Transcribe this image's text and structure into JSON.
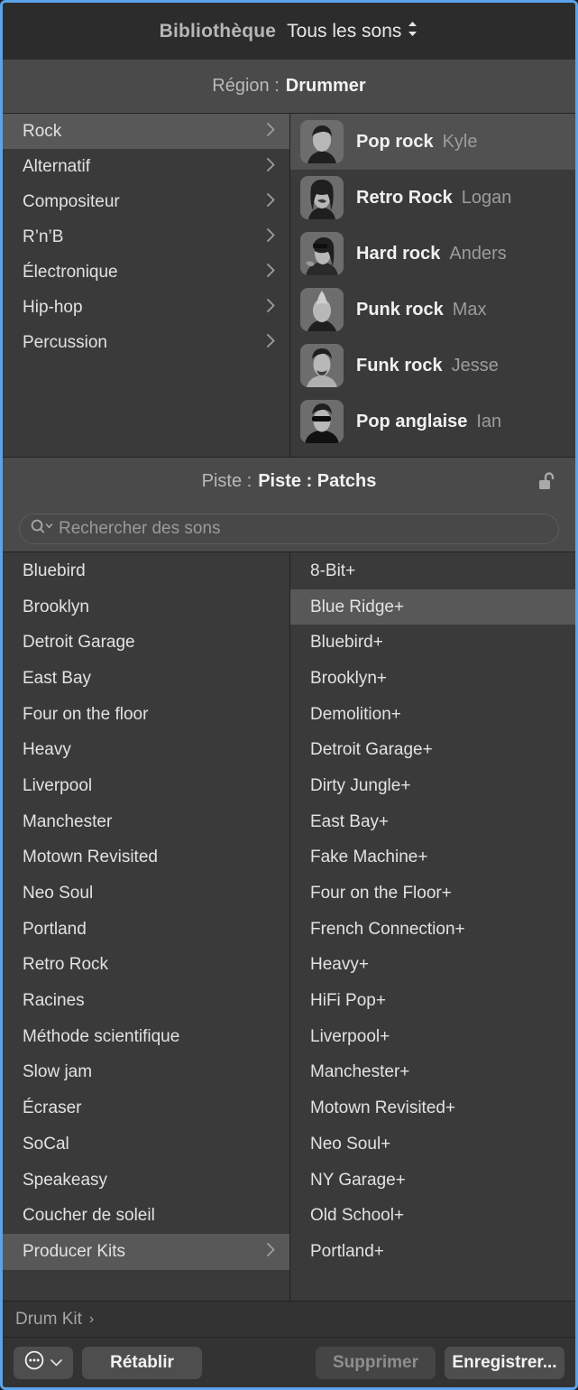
{
  "library": {
    "title": "Bibliothèque",
    "filter_label": "Tous les sons",
    "filter_icon": "chevron-up-down-icon"
  },
  "region": {
    "label": "Région :",
    "value": "Drummer"
  },
  "genres": [
    {
      "label": "Rock",
      "selected": true
    },
    {
      "label": "Alternatif",
      "selected": false
    },
    {
      "label": "Compositeur",
      "selected": false
    },
    {
      "label": "R’n’B",
      "selected": false
    },
    {
      "label": "Électronique",
      "selected": false
    },
    {
      "label": "Hip-hop",
      "selected": false
    },
    {
      "label": "Percussion",
      "selected": false
    }
  ],
  "drummers": [
    {
      "style": "Pop rock",
      "name": "Kyle",
      "selected": true,
      "avatar": "avatar-kyle"
    },
    {
      "style": "Retro Rock",
      "name": "Logan",
      "selected": false,
      "avatar": "avatar-logan"
    },
    {
      "style": "Hard rock",
      "name": "Anders",
      "selected": false,
      "avatar": "avatar-anders"
    },
    {
      "style": "Punk rock",
      "name": "Max",
      "selected": false,
      "avatar": "avatar-max"
    },
    {
      "style": "Funk rock",
      "name": "Jesse",
      "selected": false,
      "avatar": "avatar-jesse"
    },
    {
      "style": "Pop anglaise",
      "name": "Ian",
      "selected": false,
      "avatar": "avatar-ian"
    }
  ],
  "track": {
    "label": "Piste :",
    "value": "Piste : Patchs",
    "lock_icon": "unlocked-padlock-icon"
  },
  "search": {
    "placeholder": "Rechercher des sons",
    "value": "",
    "icon": "search-icon"
  },
  "patches_left": [
    {
      "label": "Bluebird",
      "selected": false,
      "chevron": false
    },
    {
      "label": "Brooklyn",
      "selected": false,
      "chevron": false
    },
    {
      "label": "Detroit Garage",
      "selected": false,
      "chevron": false
    },
    {
      "label": "East Bay",
      "selected": false,
      "chevron": false
    },
    {
      "label": "Four on the floor",
      "selected": false,
      "chevron": false
    },
    {
      "label": "Heavy",
      "selected": false,
      "chevron": false
    },
    {
      "label": "Liverpool",
      "selected": false,
      "chevron": false
    },
    {
      "label": "Manchester",
      "selected": false,
      "chevron": false
    },
    {
      "label": "Motown Revisited",
      "selected": false,
      "chevron": false
    },
    {
      "label": "Neo Soul",
      "selected": false,
      "chevron": false
    },
    {
      "label": "Portland",
      "selected": false,
      "chevron": false
    },
    {
      "label": "Retro Rock",
      "selected": false,
      "chevron": false
    },
    {
      "label": "Racines",
      "selected": false,
      "chevron": false
    },
    {
      "label": "Méthode scientifique",
      "selected": false,
      "chevron": false
    },
    {
      "label": "Slow jam",
      "selected": false,
      "chevron": false
    },
    {
      "label": "Écraser",
      "selected": false,
      "chevron": false
    },
    {
      "label": "SoCal",
      "selected": false,
      "chevron": false
    },
    {
      "label": "Speakeasy",
      "selected": false,
      "chevron": false
    },
    {
      "label": "Coucher de soleil",
      "selected": false,
      "chevron": false
    },
    {
      "label": "Producer Kits",
      "selected": true,
      "chevron": true
    }
  ],
  "patches_right": [
    {
      "label": "8-Bit+",
      "selected": false
    },
    {
      "label": "Blue Ridge+",
      "selected": true
    },
    {
      "label": "Bluebird+",
      "selected": false
    },
    {
      "label": "Brooklyn+",
      "selected": false
    },
    {
      "label": "Demolition+",
      "selected": false
    },
    {
      "label": "Detroit Garage+",
      "selected": false
    },
    {
      "label": "Dirty Jungle+",
      "selected": false
    },
    {
      "label": "East Bay+",
      "selected": false
    },
    {
      "label": "Fake Machine+",
      "selected": false
    },
    {
      "label": "Four on the Floor+",
      "selected": false
    },
    {
      "label": "French Connection+",
      "selected": false
    },
    {
      "label": "Heavy+",
      "selected": false
    },
    {
      "label": "HiFi Pop+",
      "selected": false
    },
    {
      "label": "Liverpool+",
      "selected": false
    },
    {
      "label": "Manchester+",
      "selected": false
    },
    {
      "label": "Motown Revisited+",
      "selected": false
    },
    {
      "label": "Neo Soul+",
      "selected": false
    },
    {
      "label": "NY Garage+",
      "selected": false
    },
    {
      "label": "Old School+",
      "selected": false
    },
    {
      "label": "Portland+",
      "selected": false
    }
  ],
  "breadcrumb": {
    "label": "Drum Kit",
    "chevron": "›"
  },
  "bottom_bar": {
    "menu_icon": "circle-ellipsis-icon",
    "menu_chevron": "chevron-down-icon",
    "revert_label": "Rétablir",
    "delete_label": "Supprimer",
    "save_label": "Enregistrer..."
  },
  "colors": {
    "focus_border": "#5ba3ea",
    "selection": "#585858",
    "panel": "#3a3a3a",
    "header": "#4a4a4a",
    "titlebar": "#2c2c2c"
  }
}
